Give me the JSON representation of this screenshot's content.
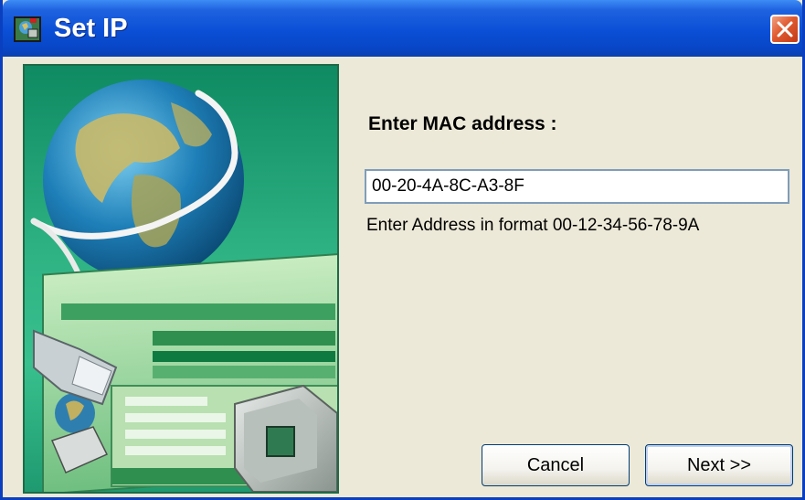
{
  "window": {
    "title": "Set IP",
    "title_bar_color": "#0a4fd6",
    "close_button_color": "#e05a30"
  },
  "icons": {
    "app": "network-globe-icon",
    "close": "close-icon"
  },
  "form": {
    "mac_label": "Enter MAC address :",
    "mac_value": "00-20-4A-8C-A3-8F",
    "hint": "Enter Address in format 00-12-34-56-78-9A"
  },
  "buttons": {
    "cancel": "Cancel",
    "next": "Next >>"
  }
}
